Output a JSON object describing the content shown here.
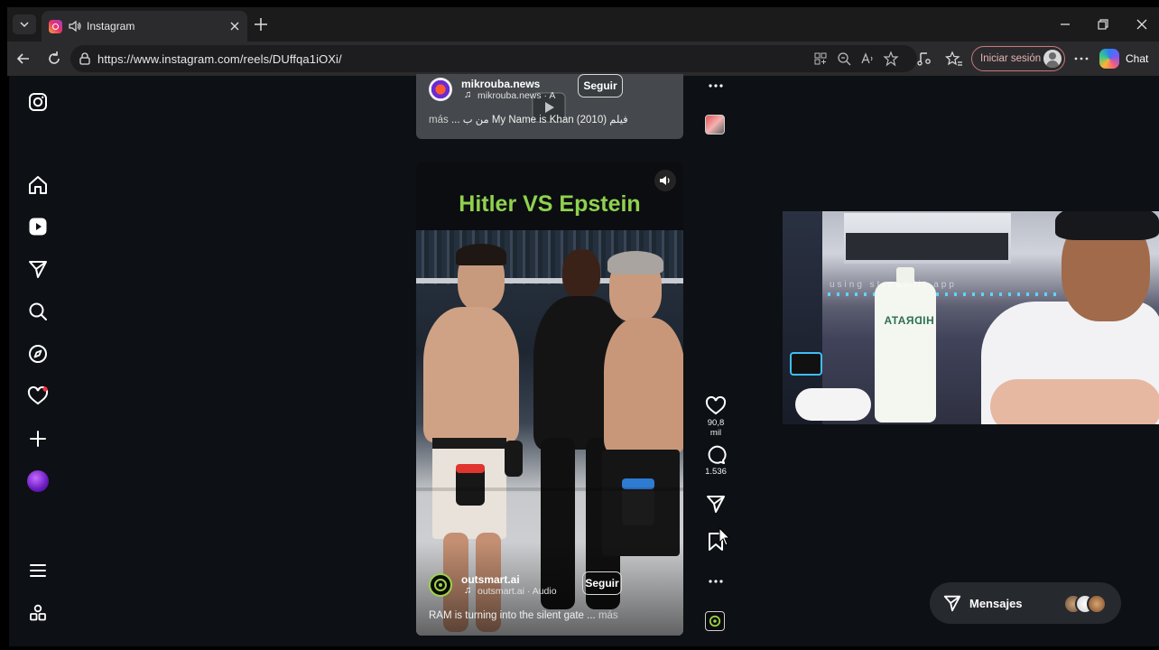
{
  "browser": {
    "tab_title": "Instagram",
    "url": "https://www.instagram.com/reels/DUffqa1iOXi/",
    "signin_label": "Iniciar sesión",
    "copilot_label": "Chat"
  },
  "top_reel": {
    "author": "mikrouba.news",
    "audio": "mikrouba.news · A",
    "follow_label": "Seguir",
    "caption_more": "más",
    "caption_text": "... من ب My Name is Khan (2010) فيلم"
  },
  "main_reel": {
    "video_title": "Hitler VS Epstein",
    "author": "outsmart.ai",
    "audio": "outsmart.ai · Audio",
    "follow_label": "Seguir",
    "caption_text": "RAM is turning into the silent gate ...",
    "caption_more": "más",
    "likes": "90,8 mil",
    "comments": "1.536"
  },
  "webcam": {
    "watermark": "using streamlit.app",
    "bottle_label": "HIDRATA"
  },
  "messages": {
    "label": "Mensajes"
  },
  "colors": {
    "page_bg": "#0d1014",
    "title_green": "#8fd14f",
    "signin_border": "#c8787c"
  }
}
